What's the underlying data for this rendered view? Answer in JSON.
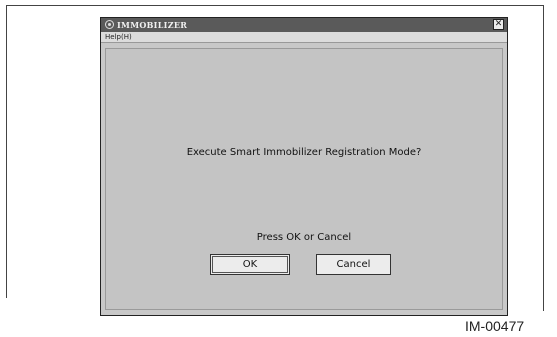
{
  "window": {
    "title": "IMMOBILIZER",
    "title_icon": "app-icon",
    "close_glyph": "✕"
  },
  "menu": {
    "help_label": "Help(H)"
  },
  "dialog": {
    "prompt": "Execute Smart Immobilizer Registration Mode?",
    "hint": "Press OK or Cancel",
    "ok_label": "OK",
    "cancel_label": "Cancel"
  },
  "figure": {
    "id": "IM-00477"
  }
}
